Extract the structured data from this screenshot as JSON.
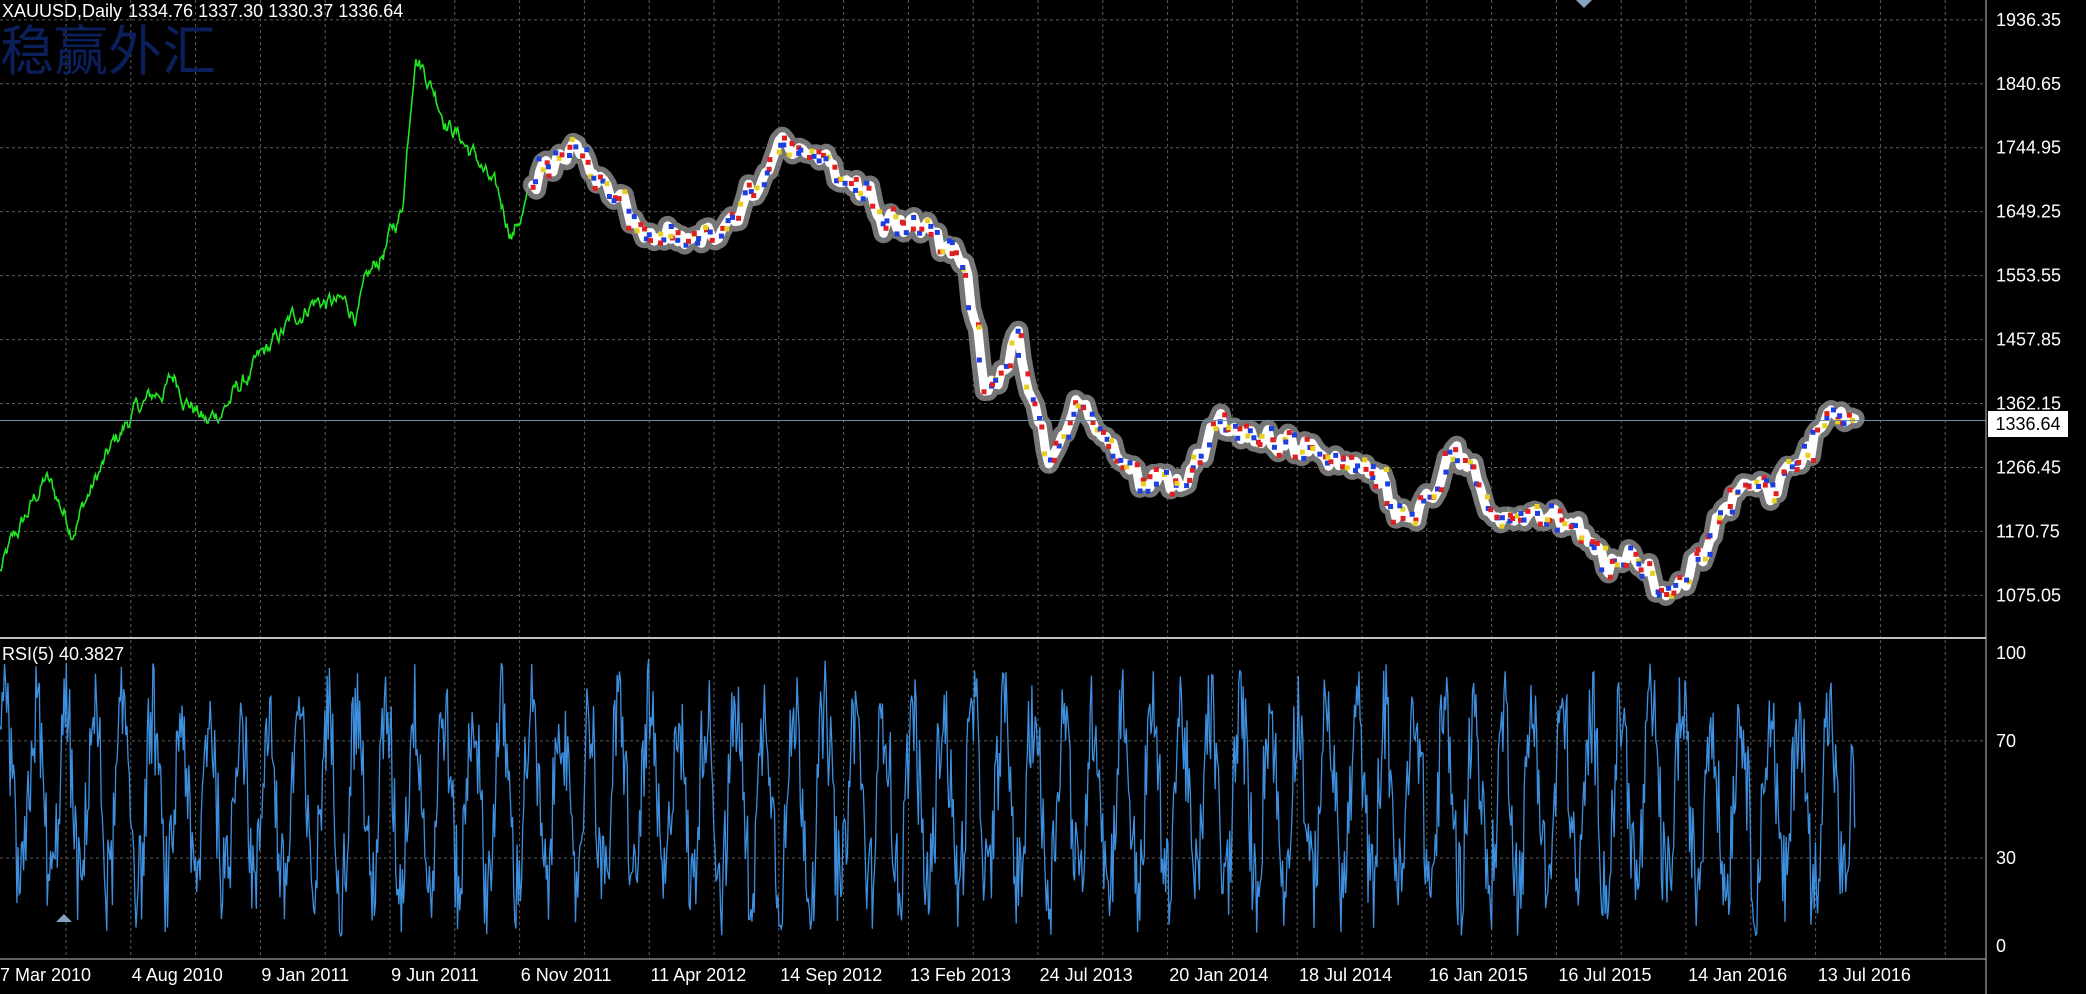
{
  "header": {
    "symbol": "XAUUSD,Daily",
    "ohlc": "1334.76 1337.30 1330.37 1336.64",
    "watermark": "稳赢外汇"
  },
  "colors": {
    "background": "#000000",
    "grid": "#5a5a5a",
    "price_line": "#22e622",
    "marker_halo": "#8a8a8a",
    "rsi_line": "#3d8fe0",
    "separator": "#bfbfbf",
    "current_price_line": "#6f8fa8"
  },
  "chart_data": [
    {
      "type": "line",
      "title": "XAUUSD,Daily",
      "x": [
        "7 Mar 2010",
        "4 Aug 2010",
        "9 Jan 2011",
        "9 Jun 2011",
        "6 Nov 2011",
        "11 Apr 2012",
        "14 Sep 2012",
        "13 Feb 2013",
        "24 Jul 2013",
        "20 Jan 2014",
        "18 Jul 2014",
        "16 Jan 2015",
        "16 Jul 2015",
        "14 Jan 2016",
        "13 Jul 2016"
      ],
      "price_keypoints": [
        [
          0,
          1110
        ],
        [
          0.35,
          1250
        ],
        [
          0.55,
          1180
        ],
        [
          1.0,
          1340
        ],
        [
          1.35,
          1400
        ],
        [
          1.6,
          1330
        ],
        [
          2.0,
          1420
        ],
        [
          2.4,
          1520
        ],
        [
          2.75,
          1500
        ],
        [
          3.1,
          1650
        ],
        [
          3.2,
          1900
        ],
        [
          3.45,
          1790
        ],
        [
          3.7,
          1720
        ],
        [
          3.95,
          1620
        ],
        [
          4.15,
          1700
        ],
        [
          4.4,
          1760
        ],
        [
          4.75,
          1660
        ],
        [
          5.1,
          1600
        ],
        [
          5.35,
          1590
        ],
        [
          5.7,
          1640
        ],
        [
          5.95,
          1720
        ],
        [
          6.2,
          1760
        ],
        [
          6.55,
          1700
        ],
        [
          6.85,
          1650
        ],
        [
          7.15,
          1630
        ],
        [
          7.45,
          1560
        ],
        [
          7.6,
          1400
        ],
        [
          7.85,
          1440
        ],
        [
          8.1,
          1260
        ],
        [
          8.3,
          1370
        ],
        [
          8.55,
          1300
        ],
        [
          8.8,
          1240
        ],
        [
          9.1,
          1250
        ],
        [
          9.4,
          1330
        ],
        [
          9.75,
          1300
        ],
        [
          10.0,
          1310
        ],
        [
          10.3,
          1280
        ],
        [
          10.6,
          1250
        ],
        [
          10.9,
          1200
        ],
        [
          11.2,
          1290
        ],
        [
          11.5,
          1200
        ],
        [
          11.8,
          1200
        ],
        [
          12.1,
          1170
        ],
        [
          12.4,
          1130
        ],
        [
          12.65,
          1110
        ],
        [
          12.9,
          1080
        ],
        [
          13.15,
          1150
        ],
        [
          13.4,
          1250
        ],
        [
          13.7,
          1240
        ],
        [
          13.9,
          1270
        ],
        [
          14.15,
          1360
        ],
        [
          14.3,
          1336.64
        ]
      ],
      "markers_start": 4.1,
      "ylabel": "",
      "y_ticks": [
        1936.35,
        1840.65,
        1744.95,
        1649.25,
        1553.55,
        1457.85,
        1362.15,
        1266.45,
        1170.75,
        1075.05
      ],
      "ylim": [
        1011.25,
        1966
      ],
      "current_price": 1336.64,
      "grid": true
    },
    {
      "type": "line",
      "title": "RSI(5) 40.3827",
      "series": [
        {
          "name": "RSI(5)",
          "last": 40.3827
        }
      ],
      "y_ticks": [
        100,
        70,
        30,
        0
      ],
      "ylim": [
        0,
        100
      ],
      "levels": [
        70,
        30
      ],
      "grid": true
    }
  ]
}
